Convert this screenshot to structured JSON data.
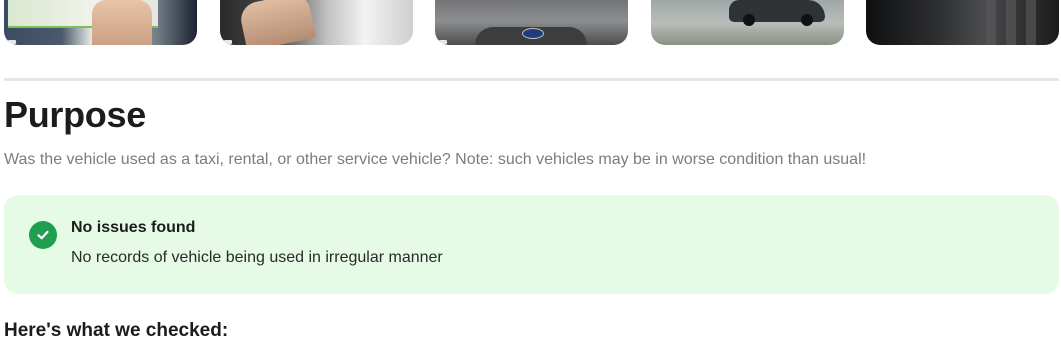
{
  "gallery": {
    "thumbnails": [
      {
        "name": "thumbnail-inspection-ticket"
      },
      {
        "name": "thumbnail-wheel-photo"
      },
      {
        "name": "thumbnail-front-hood"
      },
      {
        "name": "thumbnail-side-view"
      },
      {
        "name": "thumbnail-interior"
      }
    ]
  },
  "section": {
    "title": "Purpose",
    "description": "Was the vehicle used as a taxi, rental, or other service vehicle? Note: such vehicles may be in worse condition than usual!"
  },
  "result": {
    "icon": "check-circle-icon",
    "status_color": "#1e9e4e",
    "background_color": "#e5fbe5",
    "title": "No issues found",
    "description": "No records of vehicle being used in irregular manner"
  },
  "checked_heading": "Here's what we checked:"
}
